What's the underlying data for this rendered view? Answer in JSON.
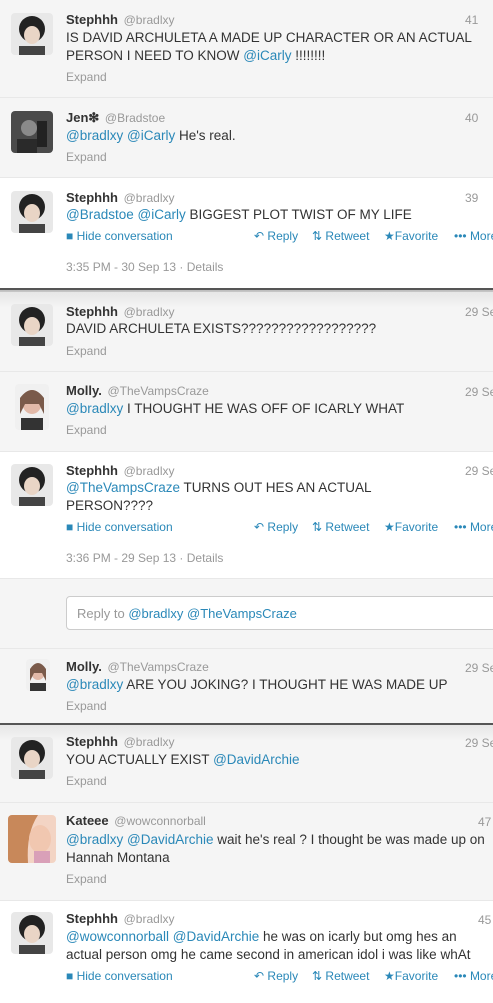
{
  "t1": {
    "name": "Stephhh",
    "handle": "@bradlxy",
    "time": "41",
    "text": "IS DAVID ARCHULETA A MADE UP CHARACTER OR AN ACTUAL PERSON I NEED TO KNOW ",
    "mention": "@iCarly",
    "tail": " !!!!!!!!",
    "expand": "Expand"
  },
  "t2": {
    "name": "Jen❇",
    "handle": "@Bradstoe",
    "time": "40",
    "m1": "@bradlxy",
    "m2": "@iCarly",
    "text": " He's real.",
    "expand": "Expand"
  },
  "t3": {
    "name": "Stephhh",
    "handle": "@bradlxy",
    "time": "39",
    "m1": "@Bradstoe",
    "m2": "@iCarly",
    "text": " BIGGEST PLOT TWIST OF MY LIFE",
    "hide": "Hide conversation",
    "reply": "Reply",
    "retweet": "Retweet",
    "favorite": "Favorite",
    "more": "••• More",
    "meta": "3:35 PM - 30 Sep 13 · Details"
  },
  "t4": {
    "name": "Stephhh",
    "handle": "@bradlxy",
    "time": "29 Se",
    "text": "DAVID ARCHULETA EXISTS??????????????????",
    "expand": "Expand"
  },
  "t5": {
    "name": "Molly.",
    "handle": "@TheVampsCraze",
    "time": "29 Se",
    "m1": "@bradlxy",
    "text": " I THOUGHT HE WAS OFF OF ICARLY WHAT",
    "expand": "Expand"
  },
  "t6": {
    "name": "Stephhh",
    "handle": "@bradlxy",
    "time": "29 Se",
    "m1": "@TheVampsCraze",
    "text": " TURNS OUT HES AN ACTUAL PERSON????",
    "hide": "Hide conversation",
    "reply": "Reply",
    "retweet": "Retweet",
    "favorite": "Favorite",
    "more": "••• More",
    "meta": "3:36 PM - 29 Sep 13 · Details"
  },
  "reply_box": {
    "prefix": "Reply to ",
    "m1": "@bradlxy",
    "m2": "@TheVampsCraze"
  },
  "t7": {
    "name": "Molly.",
    "handle": "@TheVampsCraze",
    "time": "29 Se",
    "m1": "@bradlxy",
    "text": " ARE YOU JOKING? I THOUGHT HE WAS MADE UP",
    "expand": "Expand"
  },
  "t8": {
    "name": "Stephhh",
    "handle": "@bradlxy",
    "time": "29 Se",
    "text": "YOU ACTUALLY EXIST ",
    "m1": "@DavidArchie",
    "expand": "Expand"
  },
  "t9": {
    "name": "Kateee",
    "handle": "@wowconnorball",
    "time": "47",
    "m1": "@bradlxy",
    "m2": "@DavidArchie",
    "text": " wait he's real ? I thought be was made up on Hannah Montana",
    "expand": "Expand"
  },
  "t10": {
    "name": "Stephhh",
    "handle": "@bradlxy",
    "time": "45",
    "m1": "@wowconnorball",
    "m2": "@DavidArchie",
    "text": " he was on icarly but omg hes an actual person omg he came second in american idol i was like whAt",
    "hide": "Hide conversation",
    "reply": "Reply",
    "retweet": "Retweet",
    "favorite": "Favorite",
    "more": "••• More"
  },
  "colors": {
    "link": "#2a88b8",
    "muted": "#999999",
    "text": "#333333"
  },
  "icons": {
    "reply": "reply-arrow-icon",
    "retweet": "retweet-icon",
    "favorite": "star-icon",
    "hide": "speech-bubble-icon"
  }
}
